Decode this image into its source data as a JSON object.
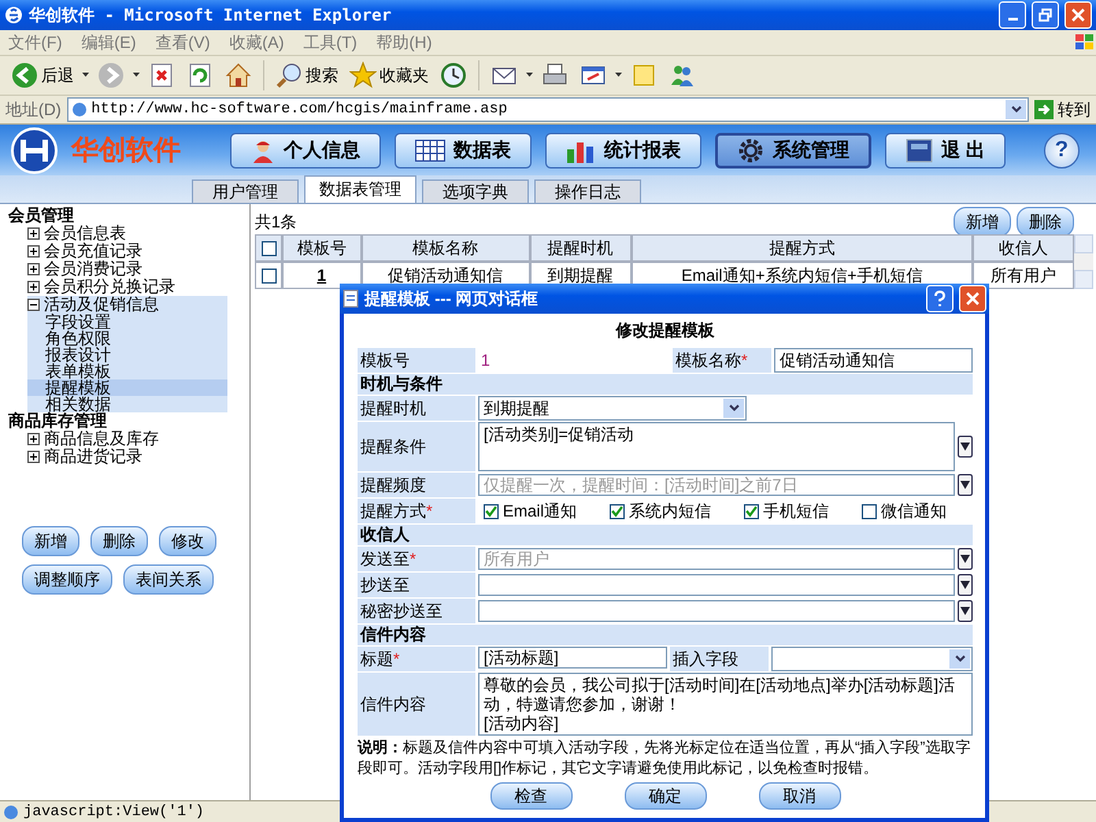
{
  "window": {
    "title": "华创软件 - Microsoft Internet Explorer"
  },
  "menu": [
    "文件(F)",
    "编辑(E)",
    "查看(V)",
    "收藏(A)",
    "工具(T)",
    "帮助(H)"
  ],
  "toolbar": [
    {
      "kind": "back",
      "label": "后退"
    },
    {
      "kind": "forward"
    },
    {
      "kind": "stop"
    },
    {
      "kind": "refresh"
    },
    {
      "kind": "home"
    },
    {
      "kind": "search",
      "label": "搜索"
    },
    {
      "kind": "favorites",
      "label": "收藏夹"
    },
    {
      "kind": "history"
    },
    {
      "kind": "mail"
    },
    {
      "kind": "print"
    },
    {
      "kind": "edit"
    },
    {
      "kind": "notes"
    },
    {
      "kind": "messenger"
    }
  ],
  "address": {
    "label": "地址(D)",
    "url": "http://www.hc-software.com/hcgis/mainframe.asp",
    "go": "转到"
  },
  "app": {
    "brand": "华创软件",
    "help": "?",
    "nav": [
      {
        "kind": "person",
        "label": "个人信息",
        "selected": false
      },
      {
        "kind": "table",
        "label": "数据表",
        "selected": false
      },
      {
        "kind": "chart",
        "label": "统计报表",
        "selected": false
      },
      {
        "kind": "gear",
        "label": "系统管理",
        "selected": true
      },
      {
        "kind": "exit",
        "label": "退 出",
        "selected": false
      }
    ]
  },
  "tabs": [
    {
      "label": "用户管理",
      "selected": false
    },
    {
      "label": "数据表管理",
      "selected": true
    },
    {
      "label": "选项字典",
      "selected": false
    },
    {
      "label": "操作日志",
      "selected": false
    }
  ],
  "sidebar": {
    "groups": [
      {
        "title": "会员管理",
        "items": [
          {
            "label": "会员信息表",
            "expanded": false
          },
          {
            "label": "会员充值记录",
            "expanded": false
          },
          {
            "label": "会员消费记录",
            "expanded": false
          },
          {
            "label": "会员积分兑换记录",
            "expanded": false
          },
          {
            "label": "活动及促销信息",
            "expanded": true,
            "children": [
              {
                "label": "字段设置",
                "selected": false
              },
              {
                "label": "角色权限",
                "selected": false
              },
              {
                "label": "报表设计",
                "selected": false
              },
              {
                "label": "表单模板",
                "selected": false
              },
              {
                "label": "提醒模板",
                "selected": true
              },
              {
                "label": "相关数据",
                "selected": false
              }
            ]
          }
        ]
      },
      {
        "title": "商品库存管理",
        "items": [
          {
            "label": "商品信息及库存",
            "expanded": false
          },
          {
            "label": "商品进货记录",
            "expanded": false
          }
        ]
      }
    ],
    "buttons": [
      [
        "新增",
        "删除",
        "修改"
      ],
      [
        "调整顺序",
        "表间关系"
      ]
    ]
  },
  "main": {
    "count": "共1条",
    "buttons": [
      "新增",
      "删除"
    ],
    "table": {
      "select_all_checked": false,
      "columns": [
        "模板号",
        "模板名称",
        "提醒时机",
        "提醒方式",
        "收信人"
      ],
      "rows": [
        {
          "checked": false,
          "cells": [
            "1",
            "促销活动通知信",
            "到期提醒",
            "Email通知+系统内短信+手机短信",
            "所有用户"
          ]
        }
      ]
    }
  },
  "dialog": {
    "title": "提醒模板 --- 网页对话框",
    "heading": "修改提醒模板",
    "template_no": {
      "label": "模板号",
      "value": "1"
    },
    "template_name": {
      "label": "模板名称",
      "required_mark": "*",
      "value": "促销活动通知信"
    },
    "sections": [
      {
        "title": "时机与条件",
        "fields": [
          {
            "kind": "select",
            "label": "提醒时机",
            "value": "到期提醒"
          },
          {
            "kind": "textarea",
            "label": "提醒条件",
            "value": "[活动类别]=促销活动",
            "picker": true
          },
          {
            "kind": "input",
            "label": "提醒频度",
            "placeholder": "仅提醒一次，提醒时间：[活动时间]之前7日",
            "picker": true
          },
          {
            "kind": "checkboxes",
            "label": "提醒方式",
            "required_mark": "*",
            "options": [
              {
                "label": "Email通知",
                "checked": true
              },
              {
                "label": "系统内短信",
                "checked": true
              },
              {
                "label": "手机短信",
                "checked": true
              },
              {
                "label": "微信通知",
                "checked": false
              }
            ]
          }
        ]
      },
      {
        "title": "收信人",
        "fields": [
          {
            "kind": "input",
            "label": "发送至",
            "required_mark": "*",
            "placeholder": "所有用户",
            "picker": true
          },
          {
            "kind": "input",
            "label": "抄送至",
            "picker": true
          },
          {
            "kind": "input",
            "label": "秘密抄送至",
            "picker": true
          }
        ]
      },
      {
        "title": "信件内容",
        "fields": [
          {
            "kind": "split",
            "label": "标题",
            "required_mark": "*",
            "value": "[活动标题]",
            "second": {
              "label": "插入字段"
            }
          },
          {
            "kind": "textarea",
            "label": "信件内容",
            "value": "尊敬的会员，我公司拟于[活动时间]在[活动地点]举办[活动标题]活动，特邀请您参加，谢谢！\n[活动内容]",
            "picker": false
          }
        ]
      }
    ],
    "note": "**说明：**标题及信件内容中可填入活动字段，先将光标定位在适当位置，再从“插入字段”选取字段即可。活动字段用[]作标记，其它文字请避免使用此标记，以免检查时报错。",
    "buttons": [
      "检查",
      "确定",
      "取消"
    ]
  },
  "status_bar": {
    "text": "javascript:View('1')"
  }
}
